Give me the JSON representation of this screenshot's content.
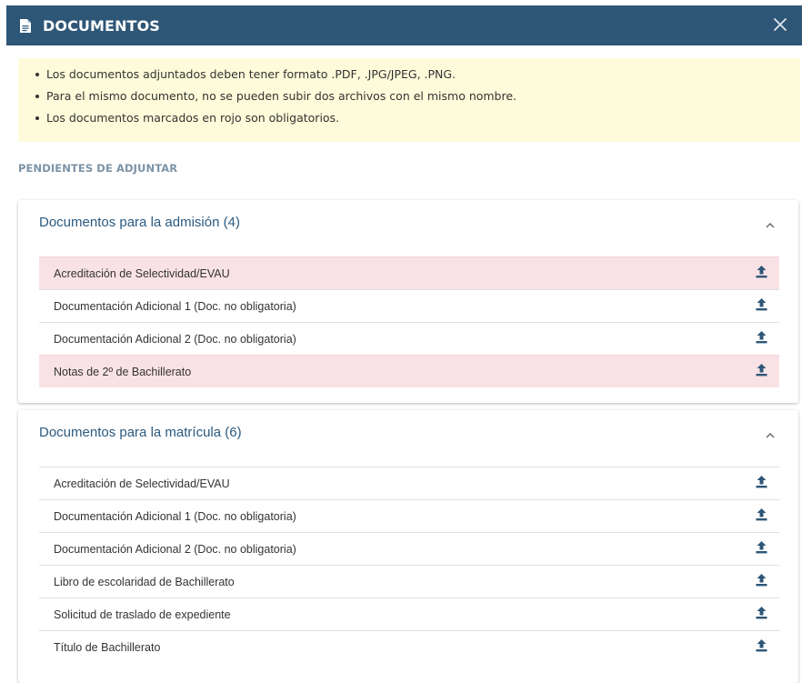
{
  "header": {
    "title": "DOCUMENTOS",
    "icon": "document-icon",
    "close_icon": "close-icon",
    "background": "#2e5677"
  },
  "notice": {
    "items": [
      "Los documentos adjuntados deben tener formato .PDF, .JPG/JPEG, .PNG.",
      "Para el mismo documento, no se pueden subir dos archivos con el mismo nombre.",
      "Los documentos marcados en rojo son obligatorios."
    ],
    "background": "#fdfbd9"
  },
  "section_title": "PENDIENTES DE ADJUNTAR",
  "groups": [
    {
      "title": "Documentos para la admisión (4)",
      "rows": [
        {
          "label": "Acreditación de Selectividad/EVAU",
          "required": true
        },
        {
          "label": "Documentación Adicional 1 (Doc. no obligatoria)",
          "required": false
        },
        {
          "label": "Documentación Adicional 2 (Doc. no obligatoria)",
          "required": false
        },
        {
          "label": "Notas de 2º de Bachillerato",
          "required": true
        }
      ]
    },
    {
      "title": "Documentos para la matrícula (6)",
      "rows": [
        {
          "label": "Acreditación de Selectividad/EVAU",
          "required": false
        },
        {
          "label": "Documentación Adicional 1 (Doc. no obligatoria)",
          "required": false
        },
        {
          "label": "Documentación Adicional 2 (Doc. no obligatoria)",
          "required": false
        },
        {
          "label": "Libro de escolaridad de Bachillerato",
          "required": false
        },
        {
          "label": "Solicitud de traslado de expediente",
          "required": false
        },
        {
          "label": "Título de Bachillerato",
          "required": false
        }
      ]
    }
  ],
  "colors": {
    "required_row": "#f9e2e6",
    "group_title": "#2b5a80",
    "upload_icon": "#2e5677",
    "section_title": "#7d93a6"
  }
}
